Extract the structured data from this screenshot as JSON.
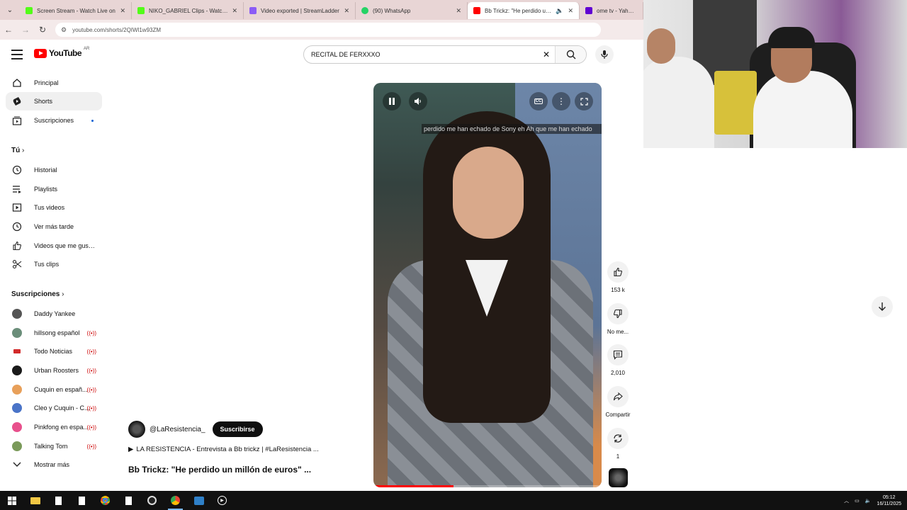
{
  "browser": {
    "tabs": [
      {
        "label": "Screen Stream - Watch Live on",
        "color": "#53fc18",
        "active": false
      },
      {
        "label": "NIKO_GABRIEL Clips - Watch Li",
        "color": "#53fc18",
        "active": false
      },
      {
        "label": "Video exported | StreamLadder",
        "color": "#8b5cf6",
        "active": false
      },
      {
        "label": "(90) WhatsApp",
        "color": "#25d366",
        "active": false
      },
      {
        "label": "Bb Trickz: \"He perdido un n",
        "color": "#ff0000",
        "active": true
      },
      {
        "label": "ome tv - Yahoo Sea",
        "color": "#6001d2",
        "active": false
      }
    ],
    "url": "youtube.com/shorts/2QIWl1w93ZM"
  },
  "header": {
    "logo_text": "YouTube",
    "country": "AR",
    "search_value": "RECITAL DE FERXXXO"
  },
  "sidebar": {
    "main": [
      {
        "label": "Principal",
        "icon": "home-icon"
      },
      {
        "label": "Shorts",
        "icon": "shorts-icon",
        "selected": true
      },
      {
        "label": "Suscripciones",
        "icon": "subscriptions-icon",
        "dot": true
      }
    ],
    "you_heading": "Tú",
    "you": [
      {
        "label": "Historial",
        "icon": "history-icon"
      },
      {
        "label": "Playlists",
        "icon": "playlists-icon"
      },
      {
        "label": "Tus videos",
        "icon": "your-videos-icon"
      },
      {
        "label": "Ver más tarde",
        "icon": "watch-later-icon"
      },
      {
        "label": "Videos que me gust...",
        "icon": "liked-videos-icon"
      },
      {
        "label": "Tus clips",
        "icon": "clips-icon"
      }
    ],
    "subs_heading": "Suscripciones",
    "subs": [
      {
        "label": "Daddy Yankee",
        "color": "#555555",
        "live": false
      },
      {
        "label": "hillsong español",
        "color": "#6b8e7a",
        "live": true
      },
      {
        "label": "Todo Noticias",
        "color": "#d22a2a",
        "live": true
      },
      {
        "label": "Urban Roosters",
        "color": "#1a1a1a",
        "live": true
      },
      {
        "label": "Cuquin en españ...",
        "color": "#e8a05a",
        "live": true
      },
      {
        "label": "Cleo y Cuquin - C...",
        "color": "#4a74c8",
        "live": true
      },
      {
        "label": "Pinkfong en espa...",
        "color": "#e8508c",
        "live": true
      },
      {
        "label": "Talking Tom",
        "color": "#7a9a5a",
        "live": true
      }
    ],
    "show_more": "Mostrar más",
    "live_glyph": "((•))"
  },
  "player": {
    "caption": "perdido me han echado de Sony eh Ah que me han echado",
    "progress": 0.35
  },
  "actions": {
    "likes": "153 k",
    "dislike": "No me...",
    "comments": "2,010",
    "share": "Compartir",
    "remix": "1"
  },
  "video": {
    "channel": "@LaResistencia_",
    "subscribe": "Suscribirse",
    "related": "LA RESISTENCIA - Entrevista a Bb trickz | #LaResistencia ...",
    "title": "Bb Trickz: \"He perdido un millón de euros\" ..."
  },
  "taskbar": {
    "time": "05:12",
    "date": "16/11/2025"
  }
}
